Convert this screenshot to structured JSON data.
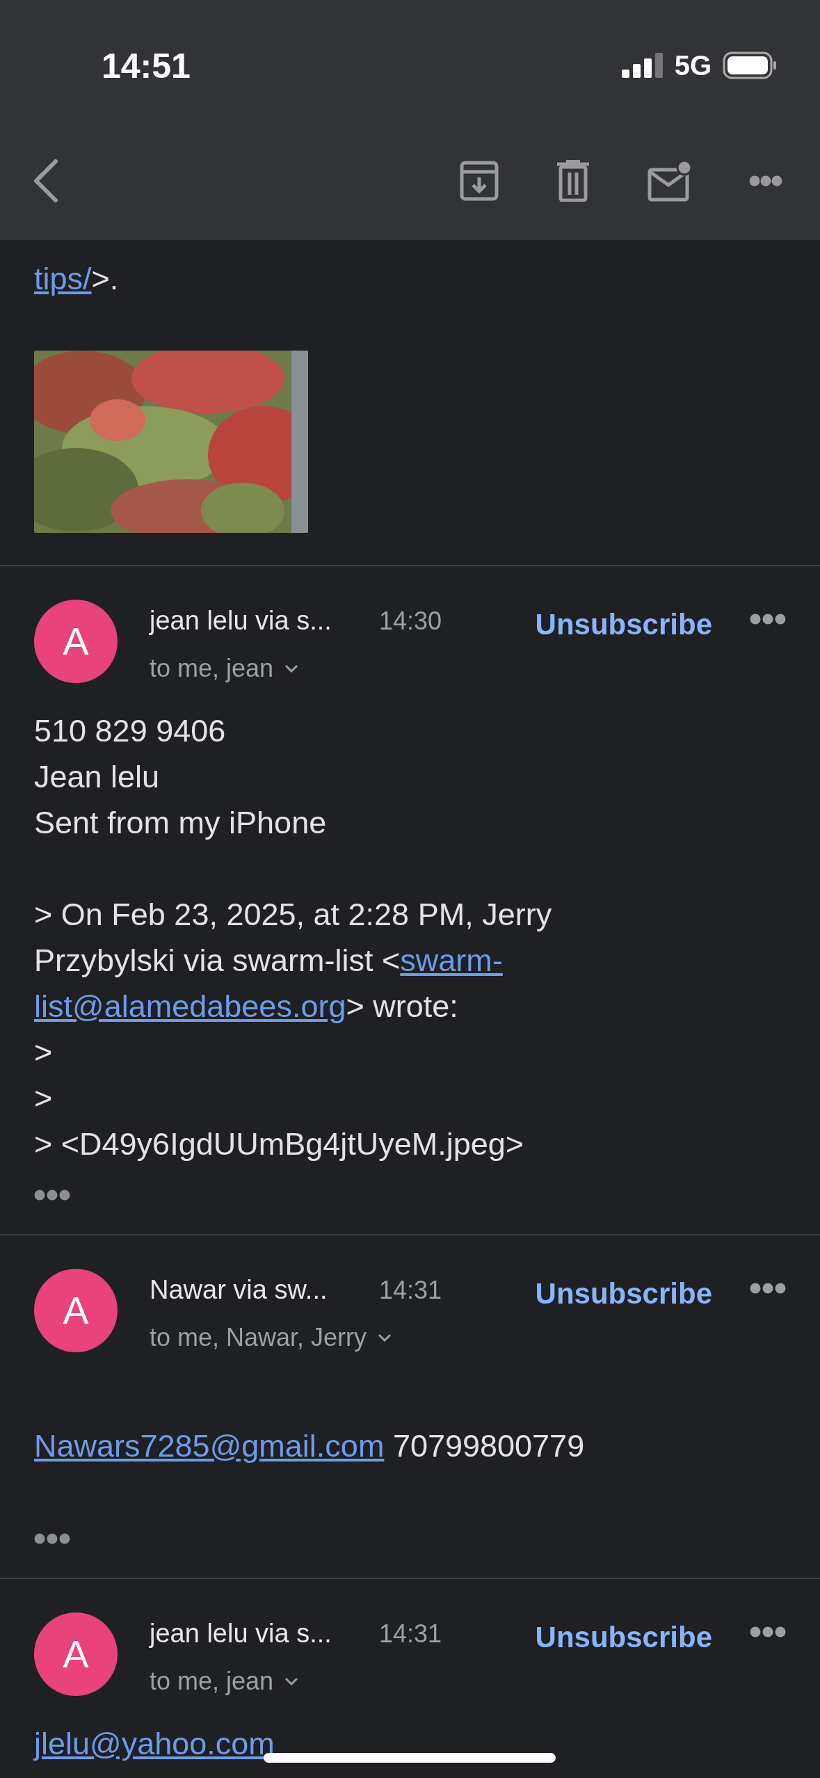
{
  "status_bar": {
    "time": "14:51",
    "network": "5G"
  },
  "quoted_footer": {
    "lines": [
      [
        {
          "kind": "link",
          "text": "tips/"
        },
        {
          "kind": "text",
          "text": ">."
        }
      ]
    ]
  },
  "messages": [
    {
      "avatar": "A",
      "sender": "jean lelu via s...",
      "time": "14:30",
      "unsubscribe": "Unsubscribe",
      "recipients": "to me, jean",
      "leading_blank": false,
      "trimmed_content": true,
      "paragraphs": [
        [
          [
            {
              "kind": "text",
              "text": "510 829 9406"
            }
          ],
          [
            {
              "kind": "text",
              "text": "Jean lelu"
            }
          ],
          [
            {
              "kind": "text",
              "text": "Sent from my iPhone"
            }
          ]
        ],
        [
          [
            {
              "kind": "text",
              "text": "> On Feb 23, 2025, at 2:28 PM, Jerry"
            }
          ],
          [
            {
              "kind": "text",
              "text": "Przybylski via swarm-list <"
            },
            {
              "kind": "link",
              "text": "swarm-"
            }
          ],
          [
            {
              "kind": "link",
              "text": "list@alamedabees.org"
            },
            {
              "kind": "text",
              "text": "> wrote:"
            }
          ],
          [
            {
              "kind": "text",
              "text": ">"
            }
          ],
          [
            {
              "kind": "text",
              "text": ">"
            }
          ],
          [
            {
              "kind": "text",
              "text": "> <D49y6IgdUUmBg4jtUyeM.jpeg>"
            }
          ]
        ]
      ]
    },
    {
      "avatar": "A",
      "sender": "Nawar via sw...",
      "time": "14:31",
      "unsubscribe": "Unsubscribe",
      "recipients": "to me, Nawar, Jerry",
      "leading_blank": true,
      "trimmed_content": true,
      "paragraphs": [
        [
          [
            {
              "kind": "link",
              "text": "Nawars7285@gmail.com"
            },
            {
              "kind": "text",
              "text": " 70799800779"
            }
          ]
        ]
      ]
    },
    {
      "avatar": "A",
      "sender": "jean lelu via s...",
      "time": "14:31",
      "unsubscribe": "Unsubscribe",
      "recipients": "to me, jean",
      "leading_blank": false,
      "trimmed_content": false,
      "paragraphs": [
        [
          [
            {
              "kind": "link",
              "text": "jlelu@yahoo.com"
            }
          ]
        ]
      ]
    }
  ]
}
